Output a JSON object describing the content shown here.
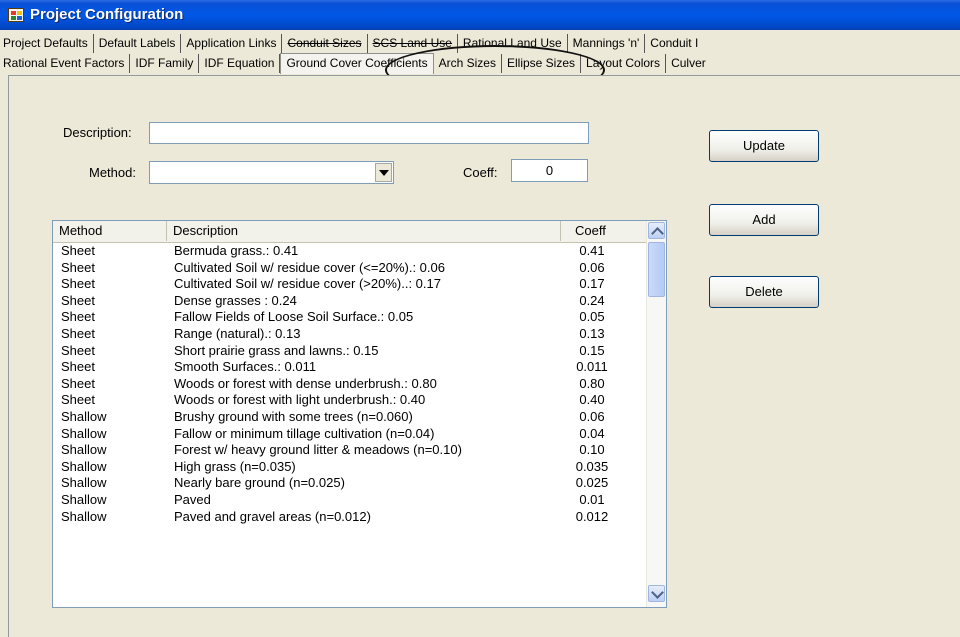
{
  "window": {
    "title": "Project Configuration"
  },
  "tabs_row1": [
    "Project Defaults",
    "Default Labels",
    "Application Links",
    "Conduit Sizes",
    "SCS Land Use",
    "Rational Land Use",
    "Mannings 'n'",
    "Conduit I"
  ],
  "tabs_row2": [
    "Rational Event Factors",
    "IDF Family",
    "IDF Equation",
    "Ground Cover Coefficients",
    "Arch Sizes",
    "Ellipse Sizes",
    "Layout Colors",
    "Culver"
  ],
  "active_tab": "Ground Cover Coefficients",
  "form": {
    "description_label": "Description:",
    "description_value": "",
    "method_label": "Method:",
    "method_value": "",
    "coeff_label": "Coeff:",
    "coeff_value": "0"
  },
  "buttons": {
    "update": "Update",
    "add": "Add",
    "delete": "Delete"
  },
  "table": {
    "headers": {
      "method": "Method",
      "description": "Description",
      "coeff": "Coeff"
    },
    "rows": [
      {
        "method": "Sheet",
        "description": "Bermuda grass.: 0.41",
        "coeff": "0.41"
      },
      {
        "method": "Sheet",
        "description": "Cultivated Soil w/ residue cover (<=20%).: 0.06",
        "coeff": "0.06"
      },
      {
        "method": "Sheet",
        "description": "Cultivated Soil w/ residue cover (>20%)..: 0.17",
        "coeff": "0.17"
      },
      {
        "method": "Sheet",
        "description": "Dense grasses : 0.24",
        "coeff": "0.24"
      },
      {
        "method": "Sheet",
        "description": "Fallow Fields of Loose Soil Surface.: 0.05",
        "coeff": "0.05"
      },
      {
        "method": "Sheet",
        "description": "Range (natural).: 0.13",
        "coeff": "0.13"
      },
      {
        "method": "Sheet",
        "description": "Short prairie grass and lawns.: 0.15",
        "coeff": "0.15"
      },
      {
        "method": "Sheet",
        "description": "Smooth Surfaces.: 0.011",
        "coeff": "0.011"
      },
      {
        "method": "Sheet",
        "description": "Woods or forest with dense underbrush.: 0.80",
        "coeff": "0.80"
      },
      {
        "method": "Sheet",
        "description": "Woods or forest with light underbrush.: 0.40",
        "coeff": "0.40"
      },
      {
        "method": "Shallow",
        "description": "Brushy ground with some trees (n=0.060)",
        "coeff": "0.06"
      },
      {
        "method": "Shallow",
        "description": "Fallow or minimum tillage cultivation (n=0.04)",
        "coeff": "0.04"
      },
      {
        "method": "Shallow",
        "description": "Forest w/ heavy ground litter & meadows (n=0.10)",
        "coeff": "0.10"
      },
      {
        "method": "Shallow",
        "description": "High grass (n=0.035)",
        "coeff": "0.035"
      },
      {
        "method": "Shallow",
        "description": "Nearly bare ground (n=0.025)",
        "coeff": "0.025"
      },
      {
        "method": "Shallow",
        "description": "Paved",
        "coeff": "0.01"
      },
      {
        "method": "Shallow",
        "description": "Paved and gravel areas (n=0.012)",
        "coeff": "0.012"
      }
    ]
  }
}
